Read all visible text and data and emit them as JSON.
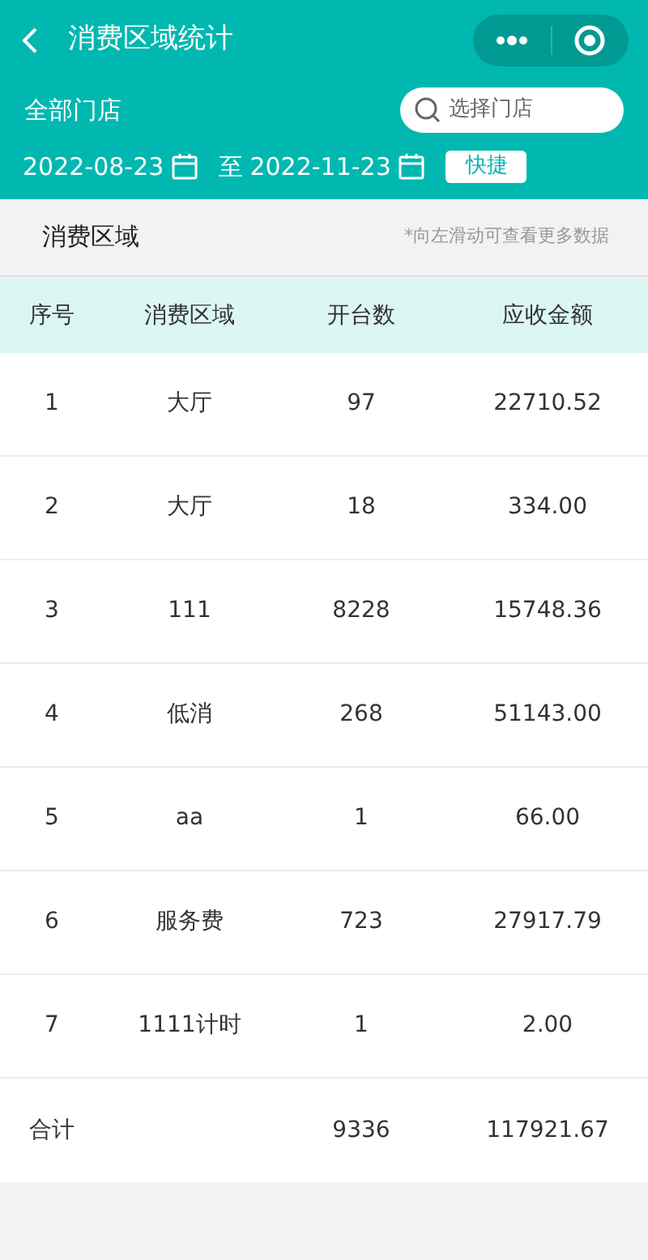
{
  "nav": {
    "title": "消费区域统计"
  },
  "store": {
    "label": "全部门店",
    "search_placeholder": "选择门店"
  },
  "dates": {
    "start": "2022-08-23",
    "separator": "至",
    "end": "2022-11-23",
    "quick_button": "快捷"
  },
  "section": {
    "title": "消费区域",
    "hint": "*向左滑动可查看更多数据"
  },
  "table": {
    "columns": [
      "序号",
      "消费区域",
      "开台数",
      "应收金额"
    ],
    "rows": [
      [
        "1",
        "大厅",
        "97",
        "22710.52"
      ],
      [
        "2",
        "大厅",
        "18",
        "334.00"
      ],
      [
        "3",
        "111",
        "8228",
        "15748.36"
      ],
      [
        "4",
        "低消",
        "268",
        "51143.00"
      ],
      [
        "5",
        "aa",
        "1",
        "66.00"
      ],
      [
        "6",
        "服务费",
        "723",
        "27917.79"
      ],
      [
        "7",
        "1111计时",
        "1",
        "2.00"
      ]
    ],
    "total": {
      "label": "合计",
      "tables": "9336",
      "amount": "117921.67"
    }
  }
}
